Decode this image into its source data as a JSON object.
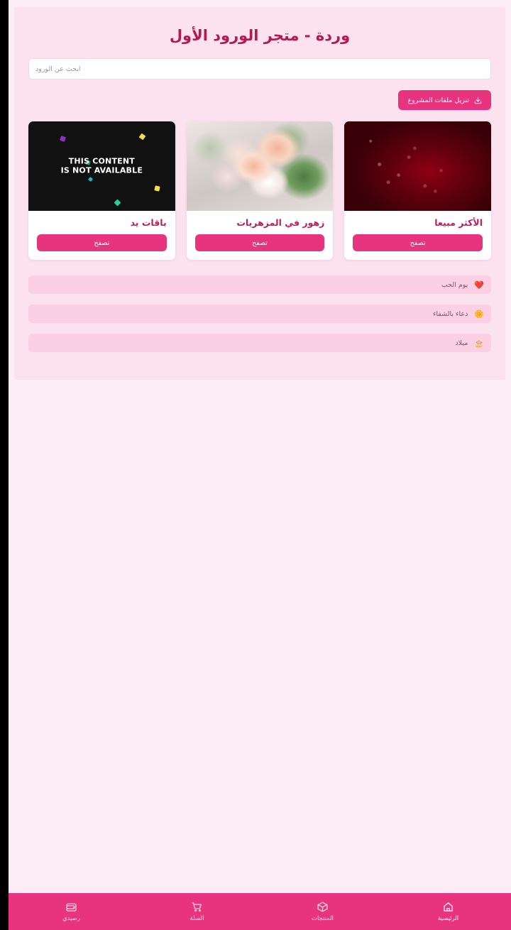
{
  "header": {
    "title": "وردة - متجر الورود الأول",
    "title_color": "#b41a52"
  },
  "search": {
    "placeholder": "ابحث عن الورود",
    "value": ""
  },
  "download": {
    "label": "تنزيل ملفات المشروع",
    "icon": "download-icon",
    "color": "#e8337f"
  },
  "cards": [
    {
      "title": "الأكثر مبيعا",
      "button": "تصفح",
      "media": "red-rose-photo",
      "available": true
    },
    {
      "title": "زهور في المزهريات",
      "button": "تصفح",
      "media": "bouquet-photo",
      "available": true
    },
    {
      "title": "باقات يد",
      "button": "تصفح",
      "media": "unavailable-placeholder",
      "available": false,
      "unavailable_line1": "THIS CONTENT",
      "unavailable_line2": "IS NOT AVAILABLE"
    }
  ],
  "occasions": [
    {
      "emoji": "❤️",
      "icon": "heart-icon",
      "label": "يوم الحب"
    },
    {
      "emoji": "🌼",
      "icon": "flower-icon",
      "label": "دعاء بالشفاء"
    },
    {
      "emoji": "🎂",
      "icon": "cake-icon",
      "label": "ميلاد"
    }
  ],
  "bottom_nav": {
    "background": "#e8337f",
    "items": [
      {
        "label": "الرئيسية",
        "icon": "home-icon",
        "active": true
      },
      {
        "label": "المنتجات",
        "icon": "box-icon",
        "active": false
      },
      {
        "label": "السلة",
        "icon": "cart-icon",
        "active": false
      },
      {
        "label": "رصيدي",
        "icon": "wallet-icon",
        "active": false
      }
    ]
  },
  "theme": {
    "panel_background": "#fbe2ee",
    "page_background": "#fdeef5",
    "accent": "#e8337f",
    "occasion_row": "#fbcfe4"
  }
}
